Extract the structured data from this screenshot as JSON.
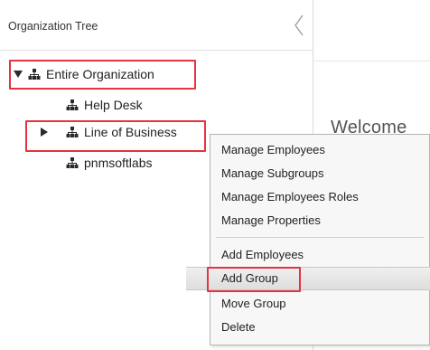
{
  "panel": {
    "title": "Organization Tree"
  },
  "welcome_text": "Welcome",
  "tree": {
    "root": {
      "label": "Entire Organization"
    },
    "children": [
      {
        "label": "Help Desk"
      },
      {
        "label": "Line of Business"
      },
      {
        "label": "pnmsoftlabs"
      }
    ]
  },
  "context_menu": {
    "group1": [
      "Manage Employees",
      "Manage Subgroups",
      "Manage Employees Roles",
      "Manage Properties"
    ],
    "group2": [
      "Add Employees",
      "Add Group",
      "Move Group",
      "Delete"
    ],
    "selected": "Add Group"
  },
  "colors": {
    "highlight_border": "#e5343f",
    "icon": "#2b2b2b"
  }
}
